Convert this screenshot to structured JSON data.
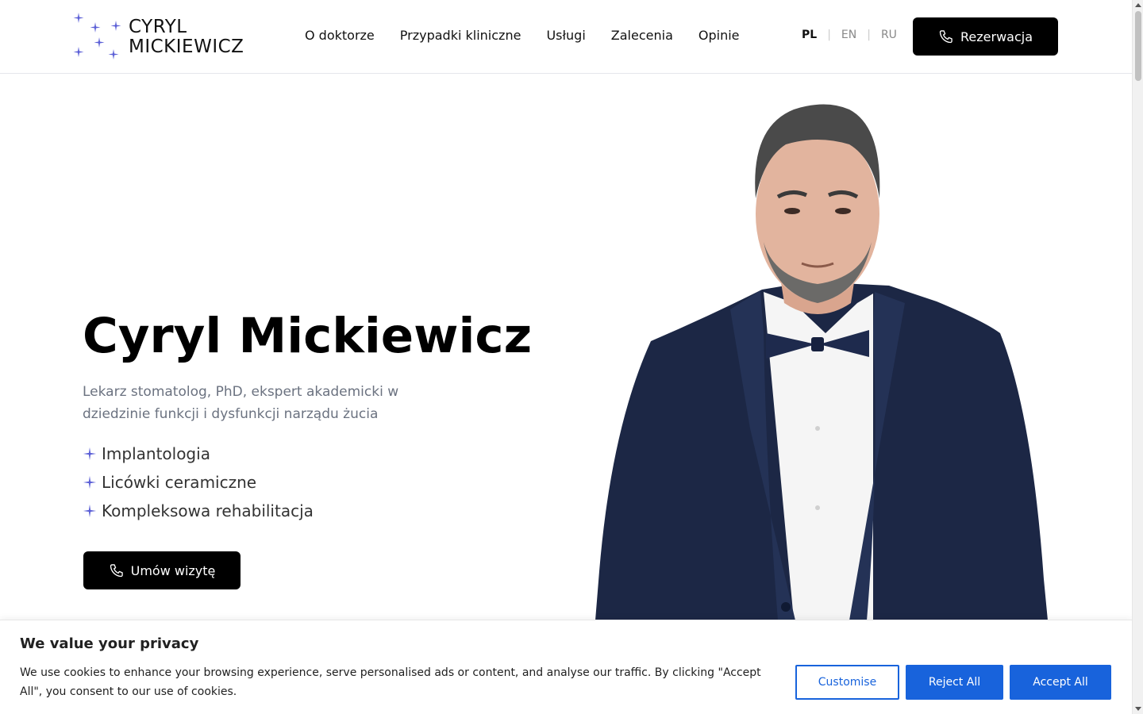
{
  "header": {
    "logo_line1": "CYRYL",
    "logo_line2": "MICKIEWICZ",
    "nav": [
      {
        "label": "O doktorze"
      },
      {
        "label": "Przypadki kliniczne"
      },
      {
        "label": "Usługi"
      },
      {
        "label": "Zalecenia"
      },
      {
        "label": "Opinie"
      }
    ],
    "languages": [
      {
        "code": "PL",
        "active": true
      },
      {
        "code": "EN",
        "active": false
      },
      {
        "code": "RU",
        "active": false
      }
    ],
    "reserve_label": "Rezerwacja"
  },
  "hero": {
    "title": "Cyryl Mickiewicz",
    "subtitle": "Lekarz stomatolog, PhD, ekspert akademicki w dziedzinie funkcji i dysfunkcji narządu żucia",
    "features": [
      {
        "label": "Implantologia"
      },
      {
        "label": "Licówki ceramiczne"
      },
      {
        "label": "Kompleksowa rehabilitacja"
      }
    ],
    "cta_label": "Umów wizytę"
  },
  "cookie_banner": {
    "title": "We value your privacy",
    "text": "We use cookies to enhance your browsing experience, serve personalised ads or content, and analyse our traffic. By clicking \"Accept All\", you consent to our use of cookies.",
    "customise_label": "Customise",
    "reject_label": "Reject All",
    "accept_label": "Accept All"
  },
  "colors": {
    "accent": "#5b5fd6",
    "cookie_button": "#1863dc",
    "suit": "#1c2745"
  },
  "icons": {
    "logo": "sparkle-stars-icon",
    "phone": "phone-icon",
    "feature_bullet": "sparkle-icon"
  }
}
